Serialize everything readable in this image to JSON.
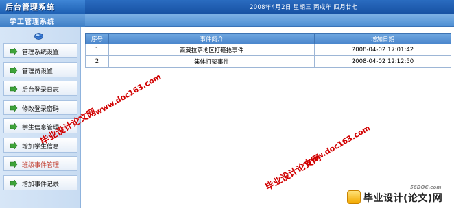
{
  "header": {
    "app_title": "后台管理系统",
    "date": "2008年4月2日 星期三 丙戌年 四月廿七"
  },
  "subheader": {
    "title": "学工管理系统"
  },
  "sidebar": {
    "items": [
      {
        "label": "管理系统设置",
        "icon": "green-arrow-icon"
      },
      {
        "label": "管理员设置",
        "icon": "green-arrow-icon"
      },
      {
        "label": "后台登录日志",
        "icon": "green-arrow-icon"
      },
      {
        "label": "修改登录密码",
        "icon": "green-arrow-icon"
      },
      {
        "label": "学生信息管理",
        "icon": "green-arrow-icon"
      },
      {
        "label": "增加学生信息",
        "icon": "green-arrow-icon"
      },
      {
        "label": "班级事件管理",
        "icon": "green-arrow-icon",
        "active": true
      },
      {
        "label": "增加事件记录",
        "icon": "green-arrow-icon"
      }
    ]
  },
  "table": {
    "columns": [
      "序号",
      "事件简介",
      "增加日期"
    ],
    "rows": [
      [
        "1",
        "西藏拉萨地区打砸抢事件",
        "2008-04-02 17:01:42"
      ],
      [
        "2",
        "集体打架事件",
        "2008-04-02 12:12:50"
      ]
    ]
  },
  "watermarks": {
    "w1": "毕业设计论文网",
    "w2": "www.doc163.com",
    "w3": "毕业设计论文网",
    "w4": "www.doc163.com"
  },
  "footer_logo": {
    "site": "56DOC.com",
    "name": "毕业设计(论文)网"
  },
  "colors": {
    "header_blue": "#1751a3",
    "sidebar_bg": "#d7e6f7",
    "table_header": "#4a86cc",
    "watermark_red": "#d10000",
    "active_link": "#c0392b"
  }
}
